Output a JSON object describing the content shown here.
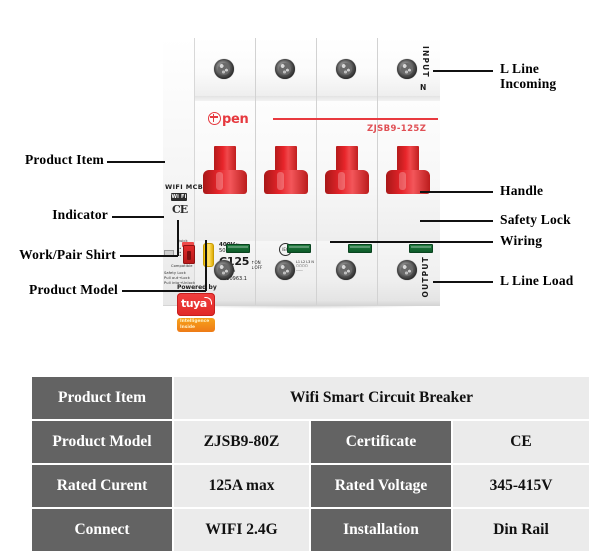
{
  "callouts": {
    "left": [
      {
        "id": "product-item",
        "text": "Product Item"
      },
      {
        "id": "indicator",
        "text": "Indicator"
      },
      {
        "id": "work-pair-shirt",
        "text": "Work/Pair Shirt"
      },
      {
        "id": "product-model",
        "text": "Product Model"
      }
    ],
    "right": [
      {
        "id": "l-line-incoming",
        "text": "L Line\nIncoming"
      },
      {
        "id": "handle",
        "text": "Handle"
      },
      {
        "id": "safety-lock",
        "text": "Safety Lock"
      },
      {
        "id": "wiring",
        "text": "Wiring"
      },
      {
        "id": "l-line-load",
        "text": "L Line Load"
      }
    ]
  },
  "device": {
    "brand_name": "pen",
    "model_print": "ZJSB9-125Z",
    "input_label": "INPUT",
    "neutral_label": "N",
    "output_label": "OUTPUT",
    "wifi_mcb_label": "WIFI MCB",
    "wifi_badge": "Wi Fi",
    "ce_mark": "CE",
    "voltage_print": "400V~",
    "frequency_print": "50Hz",
    "curve_rating": "C125",
    "breaking_capacity": "6000A",
    "standard": "GB10963.1",
    "on_label": "ON",
    "off_label": "OFF",
    "powered_by": "Powered by",
    "tuya_logo": "tuya",
    "tuya_badge": "Intelligence\nInside",
    "indicator_texts": {
      "quick": "Quick",
      "compatible": "Compatible",
      "safety_lock": "Safety Lock",
      "pull_out": "Pull out→Lock",
      "pull_into": "Pull into→Unlock"
    },
    "wiring_legend": "L1 L2 L3 N",
    "iec_symbols": [
      "IEC",
      "I2"
    ],
    "colors": {
      "handle_red": "#e5242a",
      "brand_red": "#e6393f",
      "safety_lock_green": "#1f7a3d",
      "lock_tab_yellow": "#f2c20c",
      "indicator_red": "#e02b2b",
      "body_white": "#f7f7f7"
    }
  },
  "spec_table": {
    "header_bg": "#636363",
    "value_bg": "#ebebeb",
    "rows": [
      {
        "k1": "Product Item",
        "v1": "Wifi Smart Circuit Breaker",
        "k2": "",
        "v2": "",
        "span": true
      },
      {
        "k1": "Product Model",
        "v1": "ZJSB9-80Z",
        "k2": "Certificate",
        "v2": "CE"
      },
      {
        "k1": "Rated Curent",
        "v1": "125A max",
        "k2": "Rated Voltage",
        "v2": "345-415V"
      },
      {
        "k1": "Connect",
        "v1": "WIFI 2.4G",
        "k2": "Installation",
        "v2": "Din Rail"
      }
    ]
  }
}
